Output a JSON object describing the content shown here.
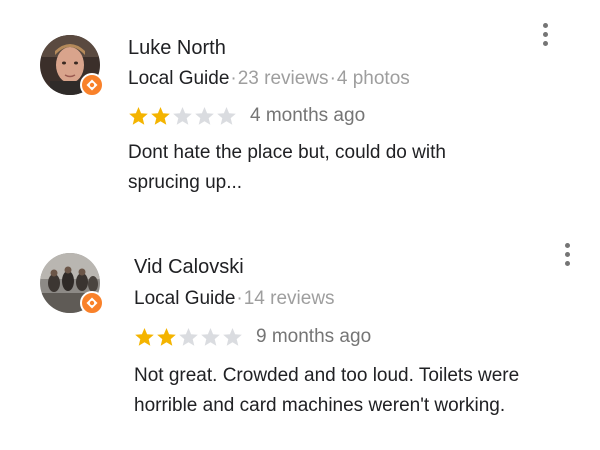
{
  "reviews": [
    {
      "author": "Luke North",
      "guide_label": "Local Guide",
      "separator": "·",
      "reviews_count": "23 reviews",
      "photos_count": "4 photos",
      "rating": 2,
      "max_rating": 5,
      "time_ago": "4 months ago",
      "text": "Dont hate the place but, could do with\nsprucing up...",
      "avatar_icon": "user-photo-icon",
      "badge_icon": "local-guide-badge-icon",
      "menu_icon": "more-vert-icon"
    },
    {
      "author": "Vid Calovski",
      "guide_label": "Local Guide",
      "separator": "·",
      "reviews_count": "14 reviews",
      "rating": 2,
      "max_rating": 5,
      "time_ago": "9 months ago",
      "text": "Not great. Crowded and too loud. Toilets were\nhorrible and card machines weren't working.",
      "avatar_icon": "user-photo-icon",
      "badge_icon": "local-guide-badge-icon",
      "menu_icon": "more-vert-icon"
    }
  ],
  "colors": {
    "star_filled": "#f4b400",
    "star_empty": "#dadce0",
    "badge": "#f9812a",
    "muted_text": "#9e9e9e"
  }
}
